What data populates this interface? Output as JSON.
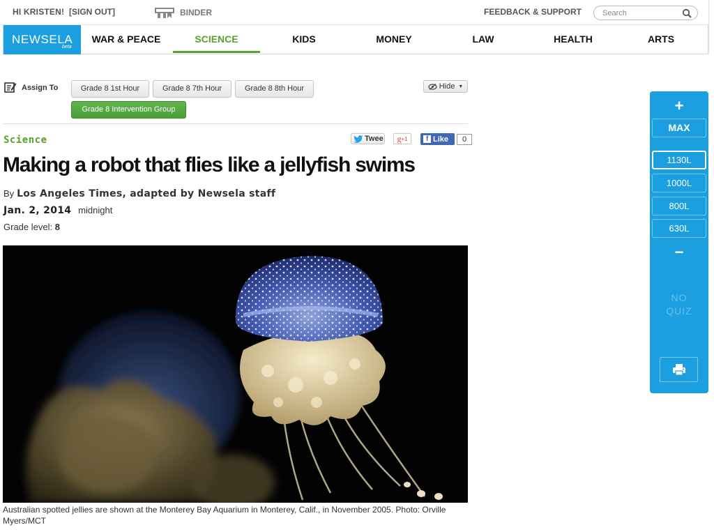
{
  "topbar": {
    "greeting": "HI KRISTEN!",
    "sign_out": "[SIGN OUT]",
    "binder": "BINDER",
    "feedback": "FEEDBACK & SUPPORT",
    "search_placeholder": "Search",
    "search_value": ""
  },
  "nav": {
    "logo": "NEWSELA",
    "logo_tag": "beta",
    "items": [
      "WAR & PEACE",
      "SCIENCE",
      "KIDS",
      "MONEY",
      "LAW",
      "HEALTH",
      "ARTS"
    ],
    "active": "SCIENCE"
  },
  "assign": {
    "label": "Assign To",
    "groups": [
      "Grade 8 1st Hour",
      "Grade 8 7th Hour",
      "Grade 8 8th Hour",
      "Grade 8 Intervention Group"
    ],
    "selected": "Grade 8 Intervention Group",
    "hide_label": "Hide"
  },
  "social": {
    "tweet": "Twee",
    "gplus": "+1",
    "like": "Like",
    "like_count": "0"
  },
  "article": {
    "section": "Science",
    "title": "Making a robot that flies like a jellyfish swims",
    "by_prefix": "By",
    "source": "Los Angeles Times, adapted by Newsela staff",
    "date": "Jan. 2, 2014",
    "time": "midnight",
    "grade_label": "Grade level:",
    "grade_value": "8",
    "caption": "Australian spotted jellies are shown at the Monterey Bay Aquarium in Monterey, Calif., in November 2005. Photo: Orville Myers/MCT"
  },
  "levels": {
    "increase": "+",
    "max": "MAX",
    "options": [
      "1130L",
      "1000L",
      "800L",
      "630L"
    ],
    "current": "1130L",
    "decrease": "−",
    "no_quiz_line1": "NO",
    "no_quiz_line2": "QUIZ"
  },
  "colors": {
    "brand_blue": "#1c9fe0",
    "science_green": "#5aa02c",
    "button_green": "#4a9d38"
  }
}
